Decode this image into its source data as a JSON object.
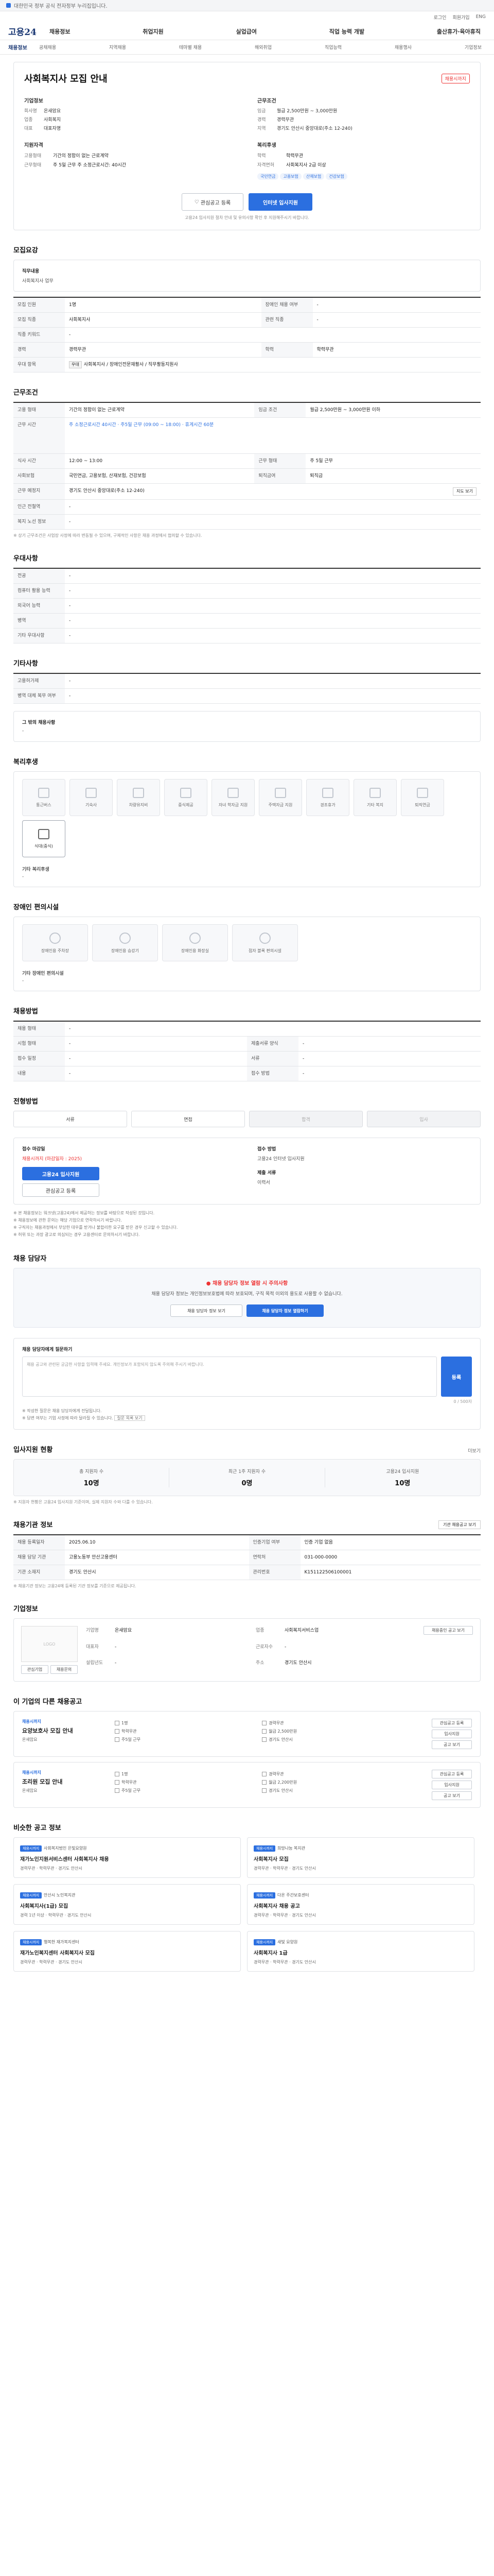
{
  "top_notice": "대한민국 정부 공식 전자정부 누리집입니다.",
  "utility": [
    "로그인",
    "회원가입",
    "ENG"
  ],
  "logo": "고용24",
  "gnb": [
    "채용정보",
    "취업지원",
    "실업급여",
    "직업 능력 개발",
    "출산휴가·육아휴직"
  ],
  "snb": {
    "home": "채용정보",
    "items": [
      "공채채용",
      "지역채용",
      "테마별 채용",
      "해외취업",
      "직업능력",
      "채용행사",
      "기업정보"
    ]
  },
  "job": {
    "title": "사회복지사 모집 안내",
    "hold": "채용시까지",
    "company_title": "기업정보",
    "company": [
      {
        "k": "회사명",
        "v": "온새암요"
      },
      {
        "k": "업종",
        "v": "사회복지"
      },
      {
        "k": "대표",
        "v": "대표자명"
      }
    ],
    "cond_title": "근무조건",
    "cond": [
      {
        "k": "임금",
        "v": "월급 2,500만원 ~ 3,000만원"
      },
      {
        "k": "경력",
        "v": "경력무관"
      },
      {
        "k": "지역",
        "v": "경기도 안산시 중앙대로(주소 12-240)"
      }
    ],
    "req_title": "지원자격",
    "req": [
      {
        "k": "학력",
        "v": "학력무관"
      },
      {
        "k": "자격면허",
        "v": "사회복지사 2급 이상"
      }
    ],
    "work_title": "복리후생",
    "work": [
      {
        "k": "고용형태",
        "v": "기간의 정함이 없는 근로계약"
      },
      {
        "k": "근무형태",
        "v": "주 5일 근무 주 소정근로시간: 40시간"
      }
    ],
    "pills": [
      "국민연금",
      "고용보험",
      "산재보험",
      "건강보험"
    ],
    "apply_online": "인터넷 입사지원",
    "scrap": "관심공고 등록",
    "note": "고용24 입사지원 절차 안내 및 유의사항 확인 후 지원해주시기 바랍니다."
  },
  "recruit": {
    "title": "모집요강",
    "job_head": "직무내용",
    "job_desc": "사회복지사 업무",
    "rows": [
      {
        "k": "모집 인원",
        "v": "1명",
        "k2": "장애인 채용 여부",
        "v2": "-"
      },
      {
        "k": "모집 직종",
        "v": "사회복지사",
        "k2": "관련 직종",
        "v2": "-"
      },
      {
        "k": "직종 키워드",
        "v": "-",
        "k2": "",
        "v2": ""
      },
      {
        "k": "경력",
        "v": "경력무관",
        "k2": "학력",
        "v2": "학력무관"
      },
      {
        "k": "우대 항목",
        "v": "사회복지사 / 장애인전문재활사 / 직무활동지원사",
        "k2": "",
        "v2": ""
      }
    ]
  },
  "work": {
    "title": "근무조건",
    "rows": [
      {
        "k": "고용 형태",
        "v": "기간의 정함이 없는 근로계약",
        "k2": "임금 조건",
        "v2": "월급 2,500만원 ~ 3,000만원 이하"
      },
      {
        "k": "근무 시간",
        "v": "주 소정근로시간 40시간 · 주5일 근무 (09:00 ~ 18:00) · 휴게시간 60분",
        "k2": "",
        "v2": ""
      },
      {
        "k": "식사 시간",
        "v": "12:00 ~ 13:00",
        "k2": "근무 형태",
        "v2": "주 5일 근무"
      },
      {
        "k": "사회보험",
        "v": "국민연금, 고용보험, 산재보험, 건강보험",
        "k2": "퇴직금여",
        "v2": "퇴직금"
      },
      {
        "k": "근무 예정지",
        "v": "경기도 안산시 중앙대로(주소 12-240)",
        "k2": "",
        "v2": ""
      },
      {
        "k": "인근 전철역",
        "v": "-",
        "k2": "",
        "v2": ""
      },
      {
        "k": "복지 노선 정보",
        "v": "-",
        "k2": "",
        "v2": ""
      }
    ],
    "map": "지도 보기",
    "footnote": "※ 상기 근무조건은 사업장 사정에 따라 변동될 수 있으며, 구체적인 사항은 채용 과정에서 협의할 수 있습니다."
  },
  "pref": {
    "title": "우대사항",
    "rows": [
      {
        "k": "전공",
        "v": "-"
      },
      {
        "k": "컴퓨터 활용 능력",
        "v": "-"
      },
      {
        "k": "외국어 능력",
        "v": "-"
      },
      {
        "k": "병역",
        "v": "-"
      },
      {
        "k": "기타 우대사항",
        "v": "-"
      }
    ]
  },
  "etc": {
    "title": "기타사항",
    "rows": [
      {
        "k": "고용허가제",
        "v": "-"
      },
      {
        "k": "병역 대체 복무 여부",
        "v": "-"
      }
    ],
    "more": "그 밖의 채용사항",
    "more_v": "-"
  },
  "welfare": {
    "title": "복리후생",
    "tiles": [
      {
        "label": "통근버스",
        "on": false
      },
      {
        "label": "기숙사",
        "on": false
      },
      {
        "label": "차량유지비",
        "on": false
      },
      {
        "label": "중식제공",
        "on": false
      },
      {
        "label": "자녀 학자금 지원",
        "on": false
      },
      {
        "label": "주택자금 지원",
        "on": false
      },
      {
        "label": "경조휴가",
        "on": false
      },
      {
        "label": "기타 복지",
        "on": false
      },
      {
        "label": "퇴직연금",
        "on": false
      },
      {
        "label": "식대(중식)",
        "on": true
      }
    ],
    "more": "기타 복리후생",
    "more_v": "-"
  },
  "disability": {
    "title": "장애인 편의시설",
    "tiles": [
      "장애인용 주차장",
      "장애인용 승강기",
      "장애인용 화장실",
      "점자 블록 편의시설"
    ],
    "more": "기타 장애인 편의시설",
    "more_v": "-"
  },
  "select": {
    "title": "채용방법",
    "rows": [
      {
        "k": "채용 형태",
        "v": "-"
      },
      {
        "k": "시험 형태",
        "v": "-",
        "k2": "제출서류 양식",
        "v2": "-"
      },
      {
        "k": "접수 일정",
        "v": "-",
        "k2": "서류",
        "v2": "-"
      },
      {
        "k": "내용",
        "v": "-",
        "k2": "접수 방법",
        "v2": "-"
      }
    ]
  },
  "process": {
    "title": "전형방법",
    "steps": [
      "서류",
      "면접",
      "합격",
      "입사"
    ]
  },
  "apply": {
    "title_left": "접수 마감일",
    "deadline": "채용시까지 (마감일자 : 2025)",
    "apply": "고용24 입사지원",
    "scrap": "관심공고 등록",
    "way_title": "접수 방법",
    "way": "고용24 인터넷 입사지원",
    "docs_title": "제출 서류",
    "docs": "이력서",
    "notes": [
      "※ 본 채용정보는 워크넷(고용24)에서 제공하는 정보를 바탕으로 작성된 것입니다.",
      "※ 채용정보에 관한 문의는 해당 기업으로 연락하시기 바랍니다.",
      "※ 구직자는 채용과정에서 부당한 대우를 받거나 불합리한 요구를 받은 경우 신고할 수 있습니다.",
      "※ 허위 또는 과장 광고로 의심되는 경우 고용센터로 문의하시기 바랍니다."
    ]
  },
  "contact": {
    "title": "채용 담당자",
    "alert": "채용 담당자 정보 열람 시 주의사항",
    "desc": "채용 담당자 정보는 개인정보보호법에 따라 보호되며, 구직 목적 이외의 용도로 사용할 수 없습니다.",
    "btn1": "채용 담당자 정보 보기",
    "btn2": "채용 담당자 정보 열람하기"
  },
  "inquiry": {
    "title": "채용 담당자에게 질문하기",
    "placeholder": "채용 공고와 관련된 궁금한 사항을 입력해 주세요. 개인정보가 포함되지 않도록 주의해 주시기 바랍니다.",
    "count": "0 / 500자",
    "submit": "등록",
    "notes": [
      "※ 작성한 질문은 채용 담당자에게 전달됩니다.",
      "※ 답변 여부는 기업 사정에 따라 달라질 수 있습니다."
    ],
    "link": "질문 목록 보기"
  },
  "status": {
    "title": "입사지원 현황",
    "more": "더보기",
    "items": [
      {
        "l": "총 지원자 수",
        "n": "10명"
      },
      {
        "l": "최근 1주 지원자 수",
        "n": "0명"
      },
      {
        "l": "고용24 입사지원",
        "n": "10명"
      }
    ],
    "note": "※ 지원자 현황은 고용24 입사지원 기준이며, 실제 지원자 수와 다를 수 있습니다."
  },
  "info": {
    "title": "채용기관 정보",
    "btn": "기관 채용공고 보기",
    "rows": [
      {
        "k": "채용 등록일자",
        "v": "2025.06.10",
        "k2": "인증기업 여부",
        "v2": "인증 기업 없음"
      },
      {
        "k": "채용 담당 기관",
        "v": "고용노동부 안산고용센터",
        "k2": "연락처",
        "v2": "031-000-0000"
      },
      {
        "k": "기관 소재지",
        "v": "경기도 안산시",
        "k2": "관리번호",
        "v2": "K151122506100001"
      }
    ],
    "note": "※ 채용기관 정보는 고용24에 등록된 기관 정보를 기준으로 제공됩니다."
  },
  "corp": {
    "title": "기업정보",
    "logo": "LOGO",
    "rows": [
      {
        "k": "기업명",
        "v": "온새암요"
      },
      {
        "k": "업종",
        "v": "사회복지서비스업"
      },
      {
        "k": "대표자",
        "v": "-"
      },
      {
        "k": "근로자수",
        "v": "-"
      },
      {
        "k": "설립년도",
        "v": "-"
      },
      {
        "k": "주소",
        "v": "경기도 안산시"
      }
    ],
    "btn1": "관심기업",
    "btn2": "채용문의",
    "btn3": "채용중인 공고 보기"
  },
  "others": {
    "title": "이 기업의 다른 채용공고",
    "items": [
      {
        "tag": "채용시까지",
        "nm": "요양보호사 모집 안내",
        "co": "온새암요",
        "meta": [
          "1명",
          "경력무관",
          "학력무관",
          "월급 2,500만원",
          "주5일 근무",
          "경기도 안산시"
        ]
      },
      {
        "tag": "채용시까지",
        "nm": "조리원 모집 안내",
        "co": "온새암요",
        "meta": [
          "1명",
          "경력무관",
          "학력무관",
          "월급 2,200만원",
          "주5일 근무",
          "경기도 안산시"
        ]
      }
    ],
    "b1": "관심공고 등록",
    "b2": "입사지원",
    "b3": "공고 보기"
  },
  "similar": {
    "title": "비슷한 공고 정보",
    "items": [
      {
        "tg": "채용시까지",
        "co": "사회복지법인 은빛요양원",
        "nm": "재가노인지원서비스센터 사회복지사 채용",
        "m": "경력무관 · 학력무관 · 경기도 안산시"
      },
      {
        "tg": "채용시까지",
        "co": "희망나눔 복지관",
        "nm": "사회복지사 모집",
        "m": "경력무관 · 학력무관 · 경기도 안산시"
      },
      {
        "tg": "채용시까지",
        "co": "안산시 노인복지관",
        "nm": "사회복지사(1급) 모집",
        "m": "경력 1년 이상 · 학력무관 · 경기도 안산시"
      },
      {
        "tg": "채용시까지",
        "co": "다온 주간보호센터",
        "nm": "사회복지사 채용 공고",
        "m": "경력무관 · 학력무관 · 경기도 안산시"
      },
      {
        "tg": "채용시까지",
        "co": "행복한 재가복지센터",
        "nm": "재가노인복지센터 사회복지사 모집",
        "m": "경력무관 · 학력무관 · 경기도 안산시"
      },
      {
        "tg": "채용시까지",
        "co": "새빛 요양원",
        "nm": "사회복지사 1급",
        "m": "경력무관 · 학력무관 · 경기도 안산시"
      }
    ]
  }
}
